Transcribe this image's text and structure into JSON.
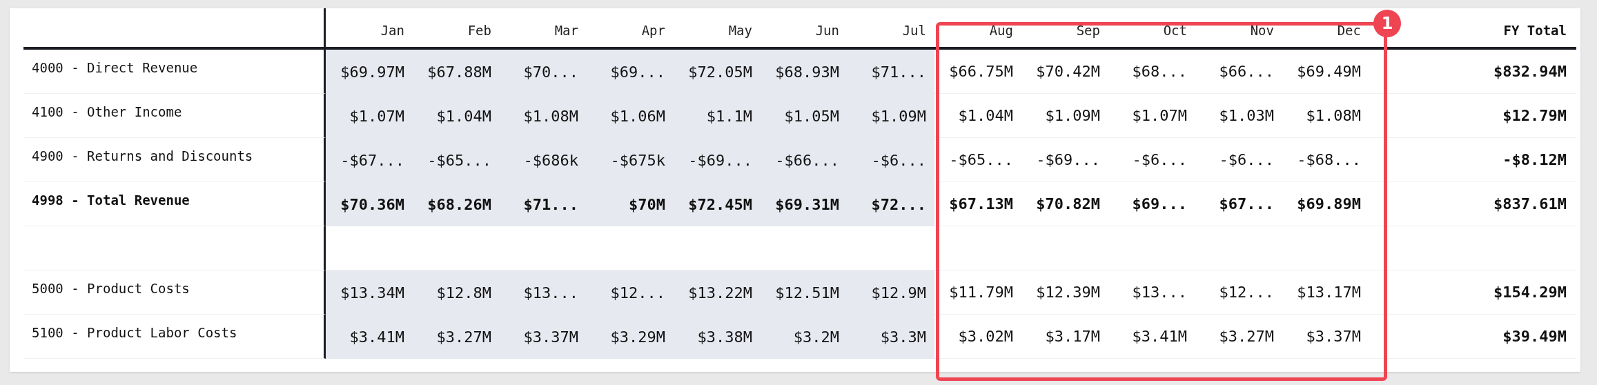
{
  "columns": [
    {
      "label": "Jan",
      "shaded": true
    },
    {
      "label": "Feb",
      "shaded": true
    },
    {
      "label": "Mar",
      "shaded": true
    },
    {
      "label": "Apr",
      "shaded": true
    },
    {
      "label": "May",
      "shaded": true
    },
    {
      "label": "Jun",
      "shaded": true
    },
    {
      "label": "Jul",
      "shaded": true
    },
    {
      "label": "Aug",
      "shaded": false
    },
    {
      "label": "Sep",
      "shaded": false
    },
    {
      "label": "Oct",
      "shaded": false
    },
    {
      "label": "Nov",
      "shaded": false
    },
    {
      "label": "Dec",
      "shaded": false
    }
  ],
  "total_column": {
    "label": "FY Total"
  },
  "rows": [
    {
      "kind": "data",
      "label": "4000 - Direct Revenue",
      "bold": false,
      "values": [
        "$69.97M",
        "$67.88M",
        "$70...",
        "$69...",
        "$72.05M",
        "$68.93M",
        "$71...",
        "$66.75M",
        "$70.42M",
        "$68...",
        "$66...",
        "$69.49M"
      ],
      "total": "$832.94M"
    },
    {
      "kind": "data",
      "label": "4100 - Other Income",
      "bold": false,
      "values": [
        "$1.07M",
        "$1.04M",
        "$1.08M",
        "$1.06M",
        "$1.1M",
        "$1.05M",
        "$1.09M",
        "$1.04M",
        "$1.09M",
        "$1.07M",
        "$1.03M",
        "$1.08M"
      ],
      "total": "$12.79M"
    },
    {
      "kind": "data",
      "label": "4900 - Returns and Discounts",
      "bold": false,
      "values": [
        "-$67...",
        "-$65...",
        "-$686k",
        "-$675k",
        "-$69...",
        "-$66...",
        "-$6...",
        "-$65...",
        "-$69...",
        "-$6...",
        "-$6...",
        "-$68..."
      ],
      "total": "-$8.12M"
    },
    {
      "kind": "data",
      "label": "4998 - Total Revenue",
      "bold": true,
      "values": [
        "$70.36M",
        "$68.26M",
        "$71...",
        "$70M",
        "$72.45M",
        "$69.31M",
        "$72...",
        "$67.13M",
        "$70.82M",
        "$69...",
        "$67...",
        "$69.89M"
      ],
      "total": "$837.61M"
    },
    {
      "kind": "spacer"
    },
    {
      "kind": "data",
      "label": "5000 - Product Costs",
      "bold": false,
      "values": [
        "$13.34M",
        "$12.8M",
        "$13...",
        "$12...",
        "$13.22M",
        "$12.51M",
        "$12.9M",
        "$11.79M",
        "$12.39M",
        "$13...",
        "$12...",
        "$13.17M"
      ],
      "total": "$154.29M"
    },
    {
      "kind": "data",
      "label": "5100 - Product Labor Costs",
      "bold": false,
      "values": [
        "$3.41M",
        "$3.27M",
        "$3.37M",
        "$3.29M",
        "$3.38M",
        "$3.2M",
        "$3.3M",
        "$3.02M",
        "$3.17M",
        "$3.41M",
        "$3.27M",
        "$3.37M"
      ],
      "total": "$39.49M"
    }
  ],
  "annotation": {
    "badge": "1"
  }
}
